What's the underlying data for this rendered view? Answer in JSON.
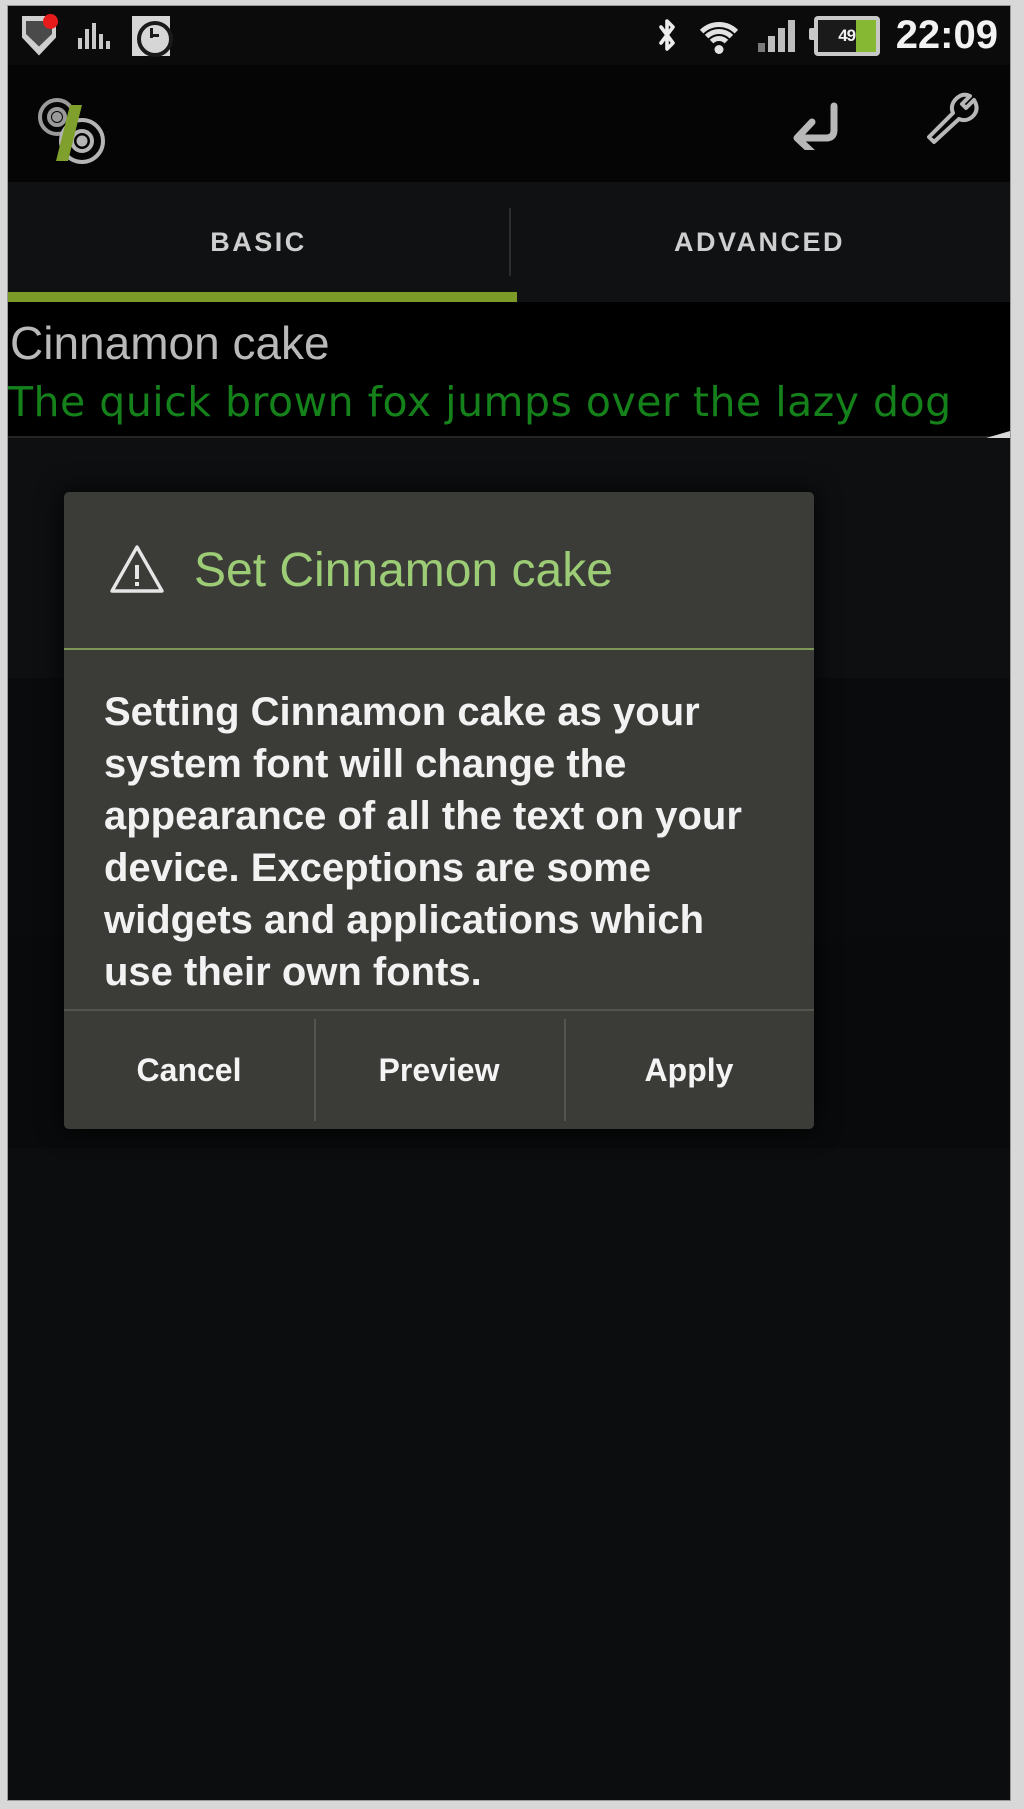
{
  "statusbar": {
    "icons_left": [
      {
        "name": "shield-notification-icon",
        "label": "shield"
      },
      {
        "name": "bar-chart-icon",
        "label": "stats"
      },
      {
        "name": "alarm-clock-icon",
        "label": "alarm"
      }
    ],
    "icons_right": [
      {
        "name": "bluetooth-icon",
        "label": "bluetooth"
      },
      {
        "name": "wifi-icon",
        "label": "wifi"
      },
      {
        "name": "cellular-signal-icon",
        "label": "signal"
      }
    ],
    "battery": {
      "level_label": "49",
      "percent": 49
    },
    "clock": "22:09"
  },
  "actionbar": {
    "app_logo_name": "gears-app-logo",
    "actions": [
      {
        "name": "undo-icon",
        "label": "Undo"
      },
      {
        "name": "wrench-icon",
        "label": "Tools"
      }
    ]
  },
  "tabs": {
    "items": [
      {
        "label": "BASIC",
        "active": true
      },
      {
        "label": "ADVANCED",
        "active": false
      }
    ],
    "indicator_color": "#7b9a28"
  },
  "font_row": {
    "name": "Cinnamon cake",
    "sample_text": "The quick brown fox jumps over the lazy dog",
    "sample_color": "#15811a"
  },
  "drawer_handle": {
    "name": "drawer-handle"
  },
  "dialog": {
    "icon_name": "warning-triangle-icon",
    "title": "Set Cinnamon cake",
    "title_color": "#9ccc75",
    "body": "Setting Cinnamon cake as your system font will change the appearance of all the text on your device. Exceptions are some widgets and applications which use their own fonts.",
    "buttons": [
      {
        "label": "Cancel",
        "name": "cancel-button"
      },
      {
        "label": "Preview",
        "name": "preview-button"
      },
      {
        "label": "Apply",
        "name": "apply-button"
      }
    ]
  }
}
